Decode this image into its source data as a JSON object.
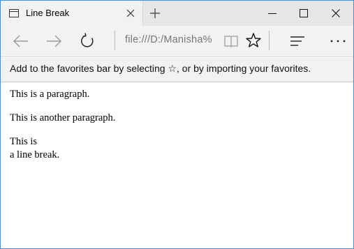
{
  "tab": {
    "title": "Line Break",
    "icon": "page-icon"
  },
  "window_controls": {
    "minimize": "minimize-icon",
    "maximize": "maximize-icon",
    "close": "close-icon"
  },
  "navbar": {
    "address": "file:///D:/Manisha%",
    "icons": [
      "back-arrow-icon",
      "forward-arrow-icon",
      "refresh-icon",
      "reading-view-icon",
      "star-icon",
      "hub-icon",
      "more-icon"
    ]
  },
  "favorites_bar": {
    "message": "Add to the favorites bar by selecting ☆, or by importing your favorites."
  },
  "page": {
    "paragraph1": "This is a paragraph.",
    "paragraph2": "This is another paragraph.",
    "paragraph3_line1": "This is",
    "paragraph3_line2": "a line break."
  },
  "colors": {
    "window_border": "#4a90d9",
    "chrome_bg": "#f2f2f2",
    "titlebar_bg": "#e6e6e6"
  }
}
